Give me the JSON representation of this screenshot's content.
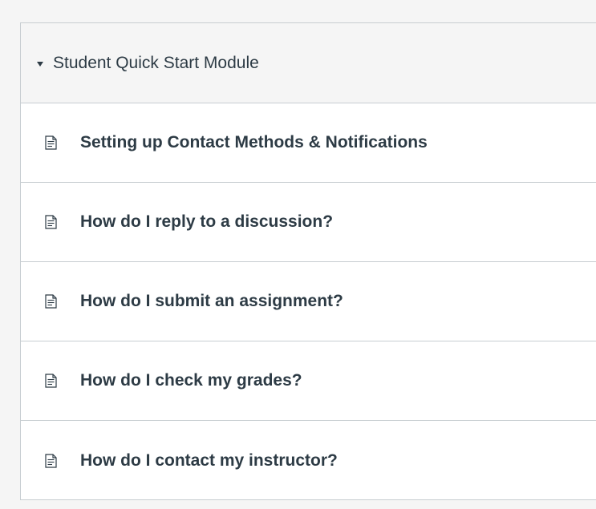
{
  "module": {
    "title": "Student Quick Start Module",
    "expanded": true,
    "header_icon": "caret-down-icon",
    "items": [
      {
        "label": "Setting up Contact Methods & Notifications",
        "icon": "page-icon"
      },
      {
        "label": "How do I reply to a discussion?",
        "icon": "page-icon"
      },
      {
        "label": "How do I submit an assignment?",
        "icon": "page-icon"
      },
      {
        "label": "How do I check my grades?",
        "icon": "page-icon"
      },
      {
        "label": "How do I contact my instructor?",
        "icon": "page-icon"
      }
    ]
  },
  "colors": {
    "text": "#2d3b45",
    "border": "#c7cdd1",
    "header_bg": "#f5f5f5",
    "item_bg": "#ffffff"
  }
}
